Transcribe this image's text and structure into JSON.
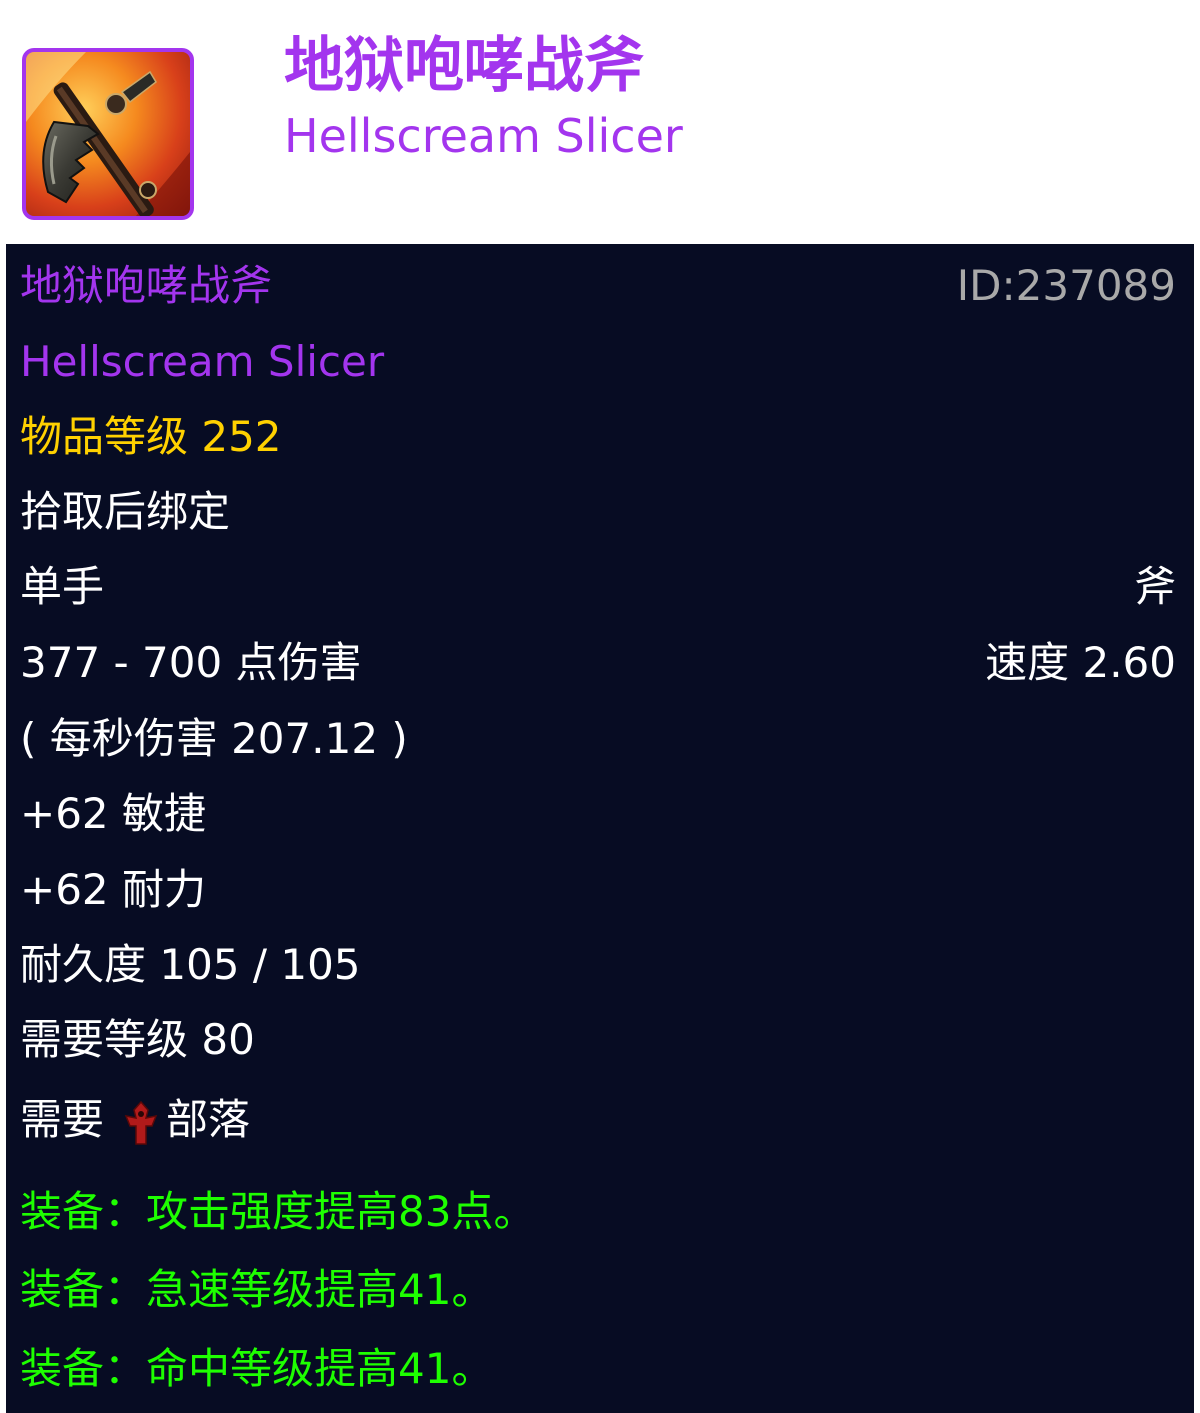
{
  "header": {
    "icon": "hellscream-slicer-axe-icon",
    "title_cn": "地狱咆哮战斧",
    "title_en": "Hellscream Slicer"
  },
  "tooltip": {
    "name_cn": "地狱咆哮战斧",
    "item_id": "ID:237089",
    "name_en": "Hellscream Slicer",
    "item_level": "物品等级 252",
    "binding": "拾取后绑定",
    "slot": "单手",
    "weapon_type": "斧",
    "damage": "377 - 700 点伤害",
    "speed": "速度 2.60",
    "dps": "( 每秒伤害 207.12 )",
    "stat_agility": "+62 敏捷",
    "stat_stamina": "+62 耐力",
    "durability": "耐久度 105 / 105",
    "required_level": "需要等级 80",
    "requires_label": "需要",
    "faction_icon": "horde-icon",
    "faction": "部落",
    "equip_1": "装备：攻击强度提高83点。",
    "equip_2": "装备：急速等级提高41。",
    "equip_3": "装备：命中等级提高41。"
  },
  "colors": {
    "epic_purple": "#a335ee",
    "item_level_gold": "#ffd100",
    "equip_green": "#1eff00",
    "tooltip_background": "#070c23",
    "id_grey": "#a9a9a9",
    "horde_red": "#b11a1a"
  }
}
